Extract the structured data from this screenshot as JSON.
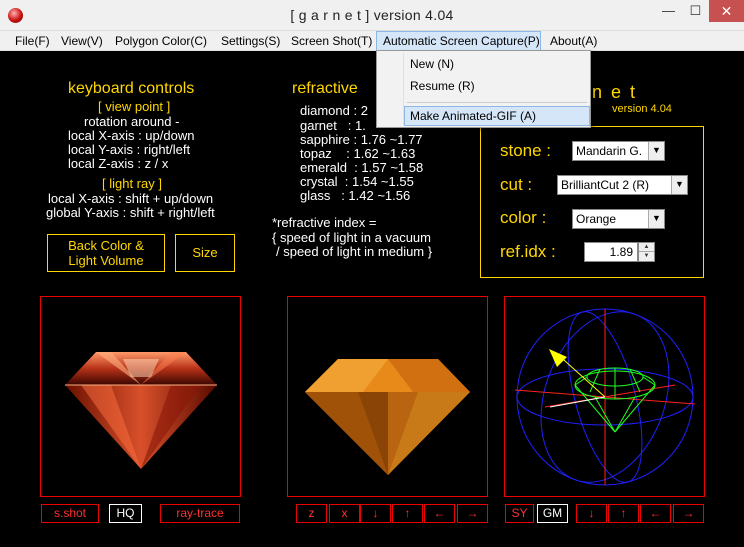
{
  "window": {
    "title": "[ g a r n e t ] version 4.04",
    "min_glyph": "—",
    "max_glyph": "☐",
    "close_glyph": "✕"
  },
  "menubar": {
    "items": [
      "File(F)",
      "View(V)",
      "Polygon Color(C)",
      "Settings(S)",
      "Screen Shot(T)",
      "Automatic Screen Capture(P)",
      "About(A)"
    ]
  },
  "dropdown": {
    "items": [
      "New (N)",
      "Resume (R)",
      "Make Animated-GIF (A)"
    ]
  },
  "keyboard": {
    "title": "keyboard controls",
    "view_point": "[ view point ]",
    "rotation": "rotation around -",
    "lines": [
      "local X-axis : up/down",
      "local Y-axis : right/left",
      "local Z-axis : z / x"
    ],
    "light_ray": "[ light ray ]",
    "light_lines": [
      "local X-axis : shift + up/down",
      "global Y-axis : shift + right/left"
    ]
  },
  "buttons": {
    "back_color": "Back Color &",
    "light_volume": "Light Volume",
    "size": "Size"
  },
  "refractive": {
    "title": "refractive",
    "rows": [
      {
        "name": "diamond",
        "value": ": 2"
      },
      {
        "name": "garnet",
        "value": ": 1."
      },
      {
        "name": "sapphire",
        "value": ": 1.76 ~1.77"
      },
      {
        "name": "topaz",
        "value": ": 1.62 ~1.63"
      },
      {
        "name": "emerald",
        "value": ": 1.57 ~1.58"
      },
      {
        "name": "crystal",
        "value": ": 1.54 ~1.55"
      },
      {
        "name": "glass",
        "value": ": 1.42 ~1.56"
      }
    ],
    "note_lines": [
      "*refractive index =",
      "{ speed of light in a vacuum",
      "/ speed of light in medium }"
    ]
  },
  "logo": {
    "title": "n e t",
    "version": "version 4.04"
  },
  "settings": {
    "stone_label": "stone :",
    "stone_value": "Mandarin G.",
    "cut_label": "cut :",
    "cut_value": "BrilliantCut 2 (R)",
    "color_label": "color :",
    "color_value": "Orange",
    "refidx_label": "ref.idx :",
    "refidx_value": "1.89"
  },
  "bottom": {
    "left": {
      "sshot": "s.shot",
      "hq": "HQ",
      "raytrace": "ray-trace"
    },
    "middle": [
      "z",
      "x",
      "↓",
      "↑",
      "←",
      "→"
    ],
    "right": {
      "sy": "SY",
      "gm": "GM",
      "arrows": [
        "↓",
        "↑",
        "←",
        "→"
      ]
    }
  },
  "colors": {
    "accent": "#ffd700",
    "panel_border": "#ee0000",
    "gem_orange": "#e8820c",
    "gem_red": "#b02a10"
  }
}
